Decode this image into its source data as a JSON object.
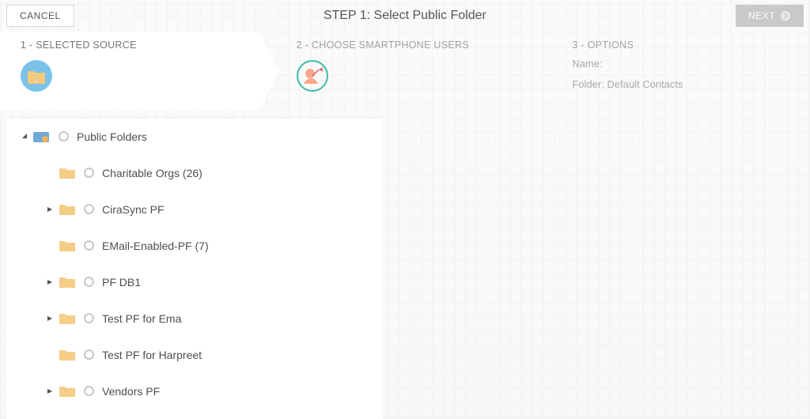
{
  "topbar": {
    "cancel_label": "CANCEL",
    "title": "STEP 1: Select Public Folder",
    "next_label": "NEXT"
  },
  "steps": {
    "s1": {
      "label": "1 - SELECTED SOURCE"
    },
    "s2": {
      "label": "2 - CHOOSE SMARTPHONE USERS"
    },
    "s3": {
      "label": "3 - OPTIONS",
      "name_label": "Name:",
      "folder_label": "Folder: Default Contacts"
    }
  },
  "tree": {
    "n0": {
      "label": "Public Folders"
    },
    "n1": {
      "label": "Charitable Orgs (26)"
    },
    "n2": {
      "label": "CiraSync PF"
    },
    "n3": {
      "label": "EMail-Enabled-PF (7)"
    },
    "n4": {
      "label": "PF DB1"
    },
    "n5": {
      "label": "Test PF for Ema"
    },
    "n6": {
      "label": "Test PF for Harpreet"
    },
    "n7": {
      "label": "Vendors PF"
    }
  }
}
